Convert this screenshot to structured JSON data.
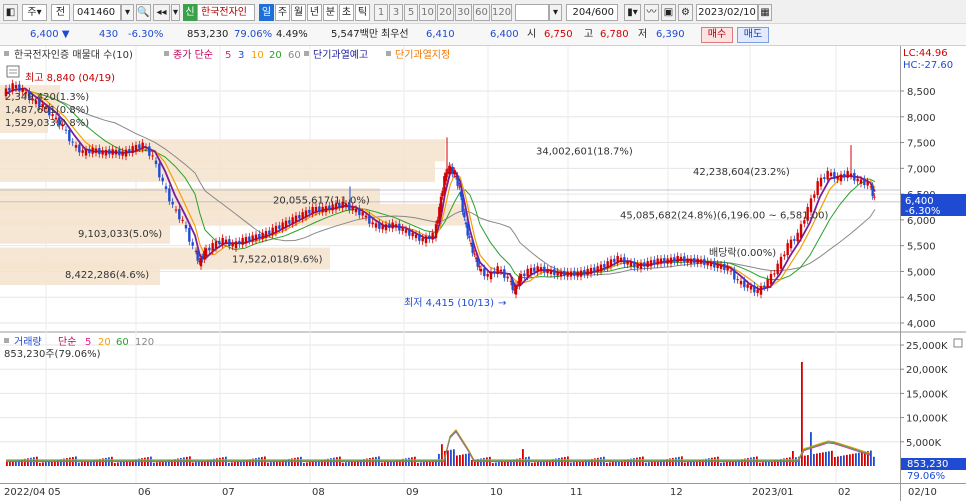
{
  "toolbar": {
    "market_select": "주",
    "period_select": "전",
    "code": "041460",
    "badge_new": "신",
    "stock_name": "한국전자인",
    "period_buttons": [
      "일",
      "주",
      "월",
      "년",
      "분",
      "초",
      "틱",
      "1",
      "3",
      "5",
      "10",
      "20",
      "30",
      "60",
      "120"
    ],
    "active_period": "일",
    "count": "204/600",
    "date": "2023/02/10"
  },
  "quote": {
    "price": "6,400",
    "change": "430",
    "change_pct": "-6.30%",
    "volume": "853,230",
    "volume_ratio": "79.06%",
    "turnover_rate": "4.49%",
    "trade_value": "5,547백만",
    "priority_label": "최우선",
    "priority_price": "6,410",
    "bid": "6,400",
    "open_label": "시",
    "open": "6,750",
    "high_label": "고",
    "high": "6,780",
    "low_label": "저",
    "low": "6,390",
    "buy_label": "매수",
    "sell_label": "매도",
    "down_color": "#1e4bd2",
    "up_color": "#d40000"
  },
  "price_panel": {
    "legend_title": "한국전자인증 매물대 수(10)",
    "legend_ma_label": "종가 단순",
    "legend_ma": [
      {
        "period": "5",
        "color": "#e0218a"
      },
      {
        "period": "3",
        "color": "#1e4bd2"
      },
      {
        "period": "10",
        "color": "#f0a000"
      },
      {
        "period": "20",
        "color": "#2aa02a"
      },
      {
        "period": "60",
        "color": "#888888"
      }
    ],
    "legend_short_warning": "단기과열예고",
    "legend_short_designated": "단기과열지정",
    "lc": "LC:44.96",
    "hc": "HC:-27.60",
    "high_mark": "최고 8,840 (04/19)",
    "low_mark": "최저 4,415 (10/13)",
    "dividend_mark": "배당락(0.00%)",
    "current_price_tag": "6,400",
    "current_pct_tag": "-6.30%",
    "y_axis": [
      "8,500",
      "8,000",
      "7,500",
      "7,000",
      "6,500",
      "6,000",
      "5,500",
      "5,000",
      "4,500",
      "4,000"
    ],
    "volume_profile": [
      {
        "label": "2,349,420(1.3%)",
        "price": 8400
      },
      {
        "label": "1,487,601(0.8%)",
        "price": 8150
      },
      {
        "label": "1,529,033(0.8%)",
        "price": 7900
      },
      {
        "label": "34,002,601(18.7%)",
        "price": 7350
      },
      {
        "label": "42,238,604(23.2%)",
        "price": 6950
      },
      {
        "label": "20,055,617(11.0%)",
        "price": 6400
      },
      {
        "label": "45,085,682(24.8%)(6,196.00 ~ 6,581.00)",
        "price": 6100
      },
      {
        "label": "9,103,033(5.0%)",
        "price": 5750
      },
      {
        "label": "17,522,018(9.6%)",
        "price": 5250
      },
      {
        "label": "8,422,286(4.6%)",
        "price": 4950
      }
    ]
  },
  "volume_panel": {
    "legend_title": "거래량",
    "legend_ma_label": "단순",
    "legend_ma": [
      {
        "period": "5",
        "color": "#e0218a"
      },
      {
        "period": "20",
        "color": "#f0a000"
      },
      {
        "period": "60",
        "color": "#2aa02a"
      },
      {
        "period": "120",
        "color": "#888888"
      }
    ],
    "current_volume": "853,230주(79.06%)",
    "y_axis": [
      "25,000K",
      "20,000K",
      "15,000K",
      "10,000K",
      "5,000K"
    ],
    "current_volume_tag": "853,230",
    "current_ratio_tag": "79.06%"
  },
  "x_axis": [
    "2022/04",
    "05",
    "06",
    "07",
    "08",
    "09",
    "10",
    "11",
    "12",
    "2023/01",
    "02",
    "02/10"
  ]
}
